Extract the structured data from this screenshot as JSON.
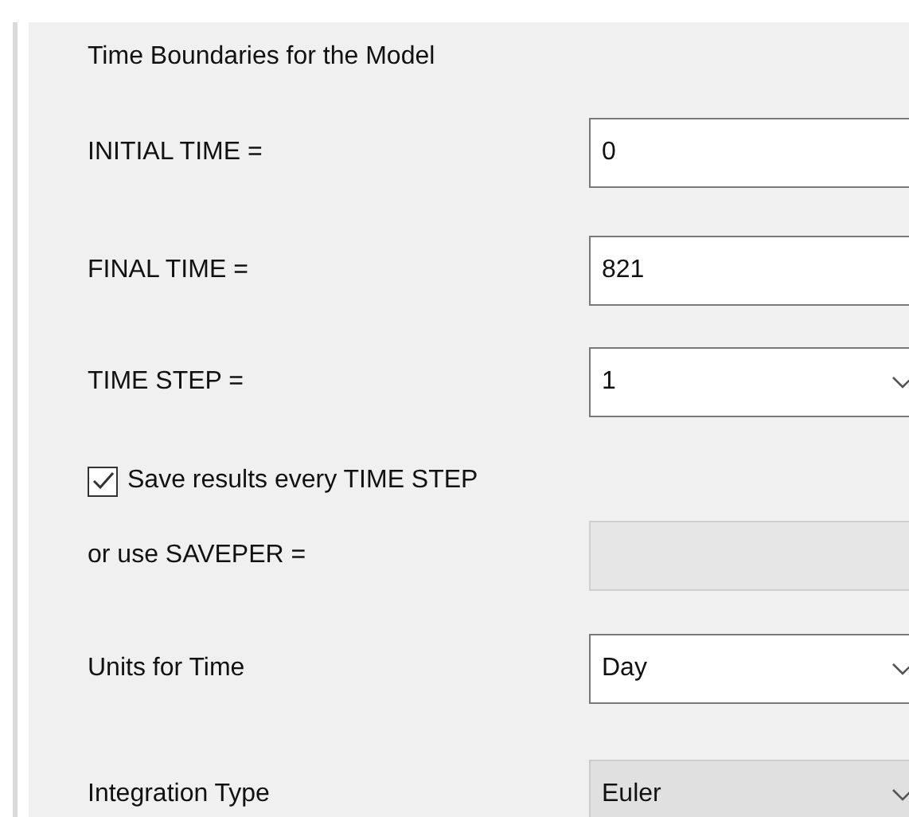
{
  "section": {
    "title": "Time Boundaries for the Model"
  },
  "rows": [
    {
      "kind": "text",
      "label": "INITIAL TIME =",
      "value": "0",
      "disabled": false
    },
    {
      "kind": "text",
      "label": "FINAL TIME =",
      "value": "821",
      "disabled": false
    },
    {
      "kind": "combo",
      "label": "TIME STEP =",
      "value": "1",
      "disabled": false
    },
    {
      "kind": "checkbox",
      "label": "Save results every TIME STEP",
      "checked": true
    },
    {
      "kind": "text",
      "label": "or use SAVEPER =",
      "disabled": true
    },
    {
      "kind": "combo",
      "label": "Units for Time",
      "value": "Day",
      "disabled": false
    },
    {
      "kind": "combo",
      "label": "Integration Type",
      "value": "Euler",
      "disabled": true
    }
  ]
}
